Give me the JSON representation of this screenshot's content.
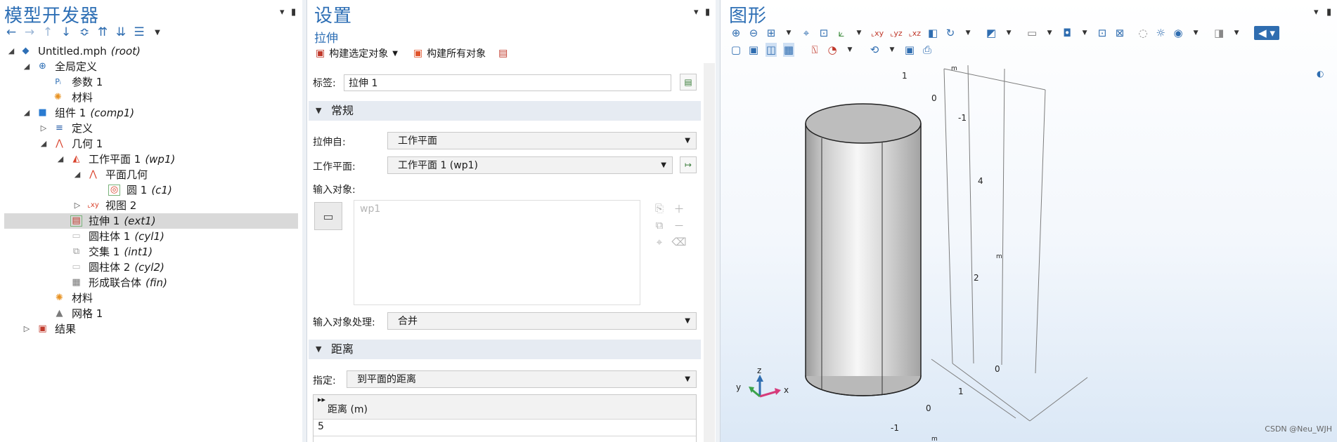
{
  "left": {
    "title": "模型开发器",
    "tree": [
      {
        "label": "Untitled.mph",
        "tag": "(root)",
        "icon": "model-icon"
      },
      {
        "label": "全局定义",
        "tag": "",
        "icon": "globe-icon"
      },
      {
        "label": "参数 1",
        "tag": "",
        "icon": "parameters-icon"
      },
      {
        "label": "材料",
        "tag": "",
        "icon": "materials-icon"
      },
      {
        "label": "组件 1",
        "tag": "(comp1)",
        "icon": "component-icon"
      },
      {
        "label": "定义",
        "tag": "",
        "icon": "definitions-icon"
      },
      {
        "label": "几何 1",
        "tag": "",
        "icon": "geometry-icon"
      },
      {
        "label": "工作平面 1",
        "tag": "(wp1)",
        "icon": "work-plane-icon"
      },
      {
        "label": "平面几何",
        "tag": "",
        "icon": "plane-geometry-icon"
      },
      {
        "label": "圆 1",
        "tag": "(c1)",
        "icon": "circle-icon"
      },
      {
        "label": "视图 2",
        "tag": "",
        "icon": "view-icon"
      },
      {
        "label": "拉伸 1",
        "tag": "(ext1)",
        "icon": "extrude-icon"
      },
      {
        "label": "圆柱体 1",
        "tag": "(cyl1)",
        "icon": "cylinder-icon"
      },
      {
        "label": "交集 1",
        "tag": "(int1)",
        "icon": "intersection-icon"
      },
      {
        "label": "圆柱体 2",
        "tag": "(cyl2)",
        "icon": "cylinder-icon"
      },
      {
        "label": "形成联合体",
        "tag": "(fin)",
        "icon": "form-union-icon"
      },
      {
        "label": "材料",
        "tag": "",
        "icon": "materials-icon"
      },
      {
        "label": "网格 1",
        "tag": "",
        "icon": "mesh-icon"
      },
      {
        "label": "结果",
        "tag": "",
        "icon": "results-icon"
      }
    ]
  },
  "settings": {
    "title": "设置",
    "subtitle": "拉伸",
    "build_selected": "构建选定对象",
    "build_all": "构建所有对象",
    "label_caption": "标签:",
    "label_value": "拉伸 1",
    "section_general": "常规",
    "extrude_from_label": "拉伸自:",
    "extrude_from_value": "工作平面",
    "workplane_label": "工作平面:",
    "workplane_value": "工作平面 1 (wp1)",
    "input_objects_label": "输入对象:",
    "input_objects_item": "wp1",
    "input_handling_label": "输入对象处理:",
    "input_handling_value": "合并",
    "section_distance": "距离",
    "specify_label": "指定:",
    "specify_value": "到平面的距离",
    "distance_header": "距离 (m)",
    "distance_value": "5"
  },
  "graphics": {
    "title": "图形",
    "axis_unit": "m",
    "ticks": {
      "top_y": [
        "1",
        "0",
        "-1"
      ],
      "z_values": [
        "4",
        "2",
        "0"
      ],
      "bottom_x": [
        "1",
        "0",
        "-1"
      ]
    },
    "triad": {
      "x": "x",
      "y": "y",
      "z": "z"
    },
    "watermark": "CSDN @Neu_WJH"
  },
  "colors": {
    "accent": "#2e6fb5",
    "selected_row": "#d9d9d9",
    "section_bg": "#e6ebf2"
  }
}
